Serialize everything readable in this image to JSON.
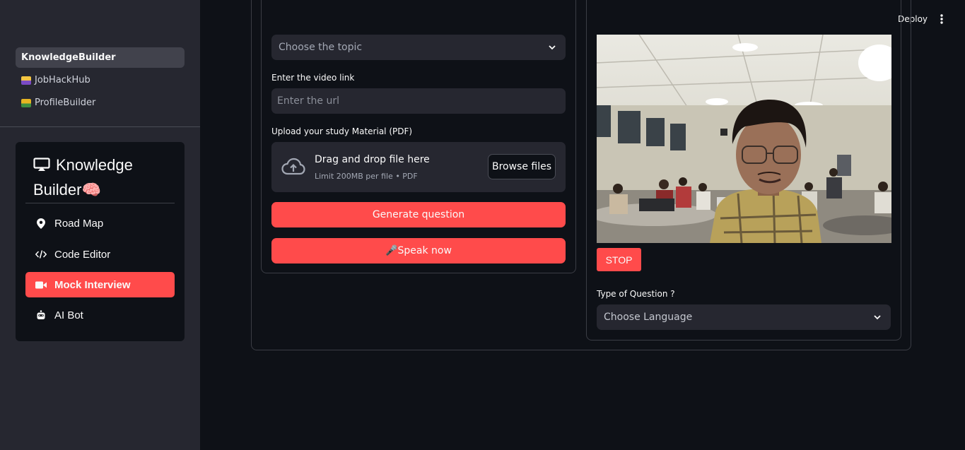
{
  "sidebar": {
    "pages": [
      {
        "label": "KnowledgeBuilder",
        "active": true
      },
      {
        "label": "JobHackHub",
        "icon": "briefcase-emoji-icon"
      },
      {
        "label": "ProfileBuilder",
        "icon": "trophy-emoji-icon"
      }
    ],
    "menu": {
      "title_line1": "Knowledge",
      "title_line2": "Builder🧠",
      "title_icon": "tv-icon",
      "items": [
        {
          "label": "Road Map",
          "icon": "map-pin-icon"
        },
        {
          "label": "Code Editor",
          "icon": "code-icon"
        },
        {
          "label": "Mock Interview",
          "icon": "video-camera-icon",
          "active": true
        },
        {
          "label": "AI Bot",
          "icon": "robot-icon"
        }
      ]
    }
  },
  "header": {
    "deploy_label": "Deploy",
    "menu_icon": "kebab-menu-icon"
  },
  "form": {
    "topic_select": {
      "placeholder": "Choose the topic"
    },
    "video_link": {
      "label": "Enter the video link",
      "placeholder": "Enter the url"
    },
    "upload": {
      "label": "Upload your study Material (PDF)",
      "main_text": "Drag and drop file here",
      "sub_text": "Limit 200MB per file • PDF",
      "browse_label": "Browse files"
    },
    "generate_label": "Generate question",
    "speak_label": "🎤Speak now"
  },
  "webcam": {
    "stop_label": "STOP"
  },
  "question_type": {
    "label": "Type of Question ?",
    "placeholder": "Choose Language"
  },
  "colors": {
    "accent": "#ff4b4b",
    "background": "#0e1117",
    "sidebar": "#262730"
  }
}
